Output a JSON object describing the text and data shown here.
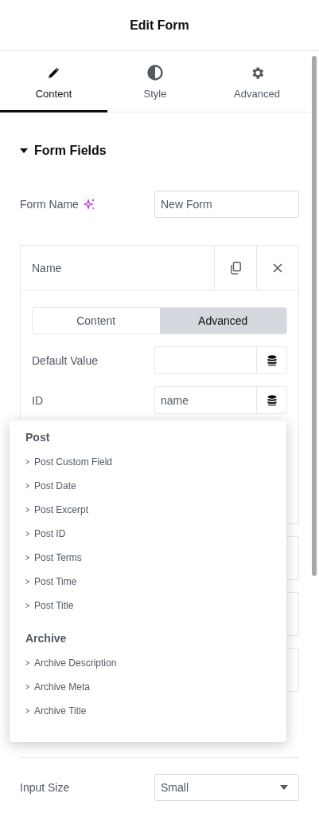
{
  "header": {
    "title": "Edit Form"
  },
  "tabs": [
    {
      "label": "Content",
      "selected": true
    },
    {
      "label": "Style",
      "selected": false
    },
    {
      "label": "Advanced",
      "selected": false
    }
  ],
  "section": {
    "title": "Form Fields",
    "expanded": true
  },
  "form_name": {
    "label": "Form Name",
    "value": "New Form"
  },
  "field_item": {
    "title": "Name",
    "subtabs": [
      {
        "label": "Content",
        "selected": false
      },
      {
        "label": "Advanced",
        "selected": true
      }
    ],
    "rows": [
      {
        "label": "Default Value"
      },
      {
        "label": "ID",
        "value": "name"
      }
    ]
  },
  "input_size": {
    "label": "Input Size",
    "value": "Small"
  },
  "dropdown": {
    "groups": [
      {
        "title": "Post",
        "items": [
          "Post Custom Field",
          "Post Date",
          "Post Excerpt",
          "Post ID",
          "Post Terms",
          "Post Time",
          "Post Title"
        ]
      },
      {
        "title": "Archive",
        "items": [
          "Archive Description",
          "Archive Meta",
          "Archive Title"
        ]
      }
    ]
  }
}
